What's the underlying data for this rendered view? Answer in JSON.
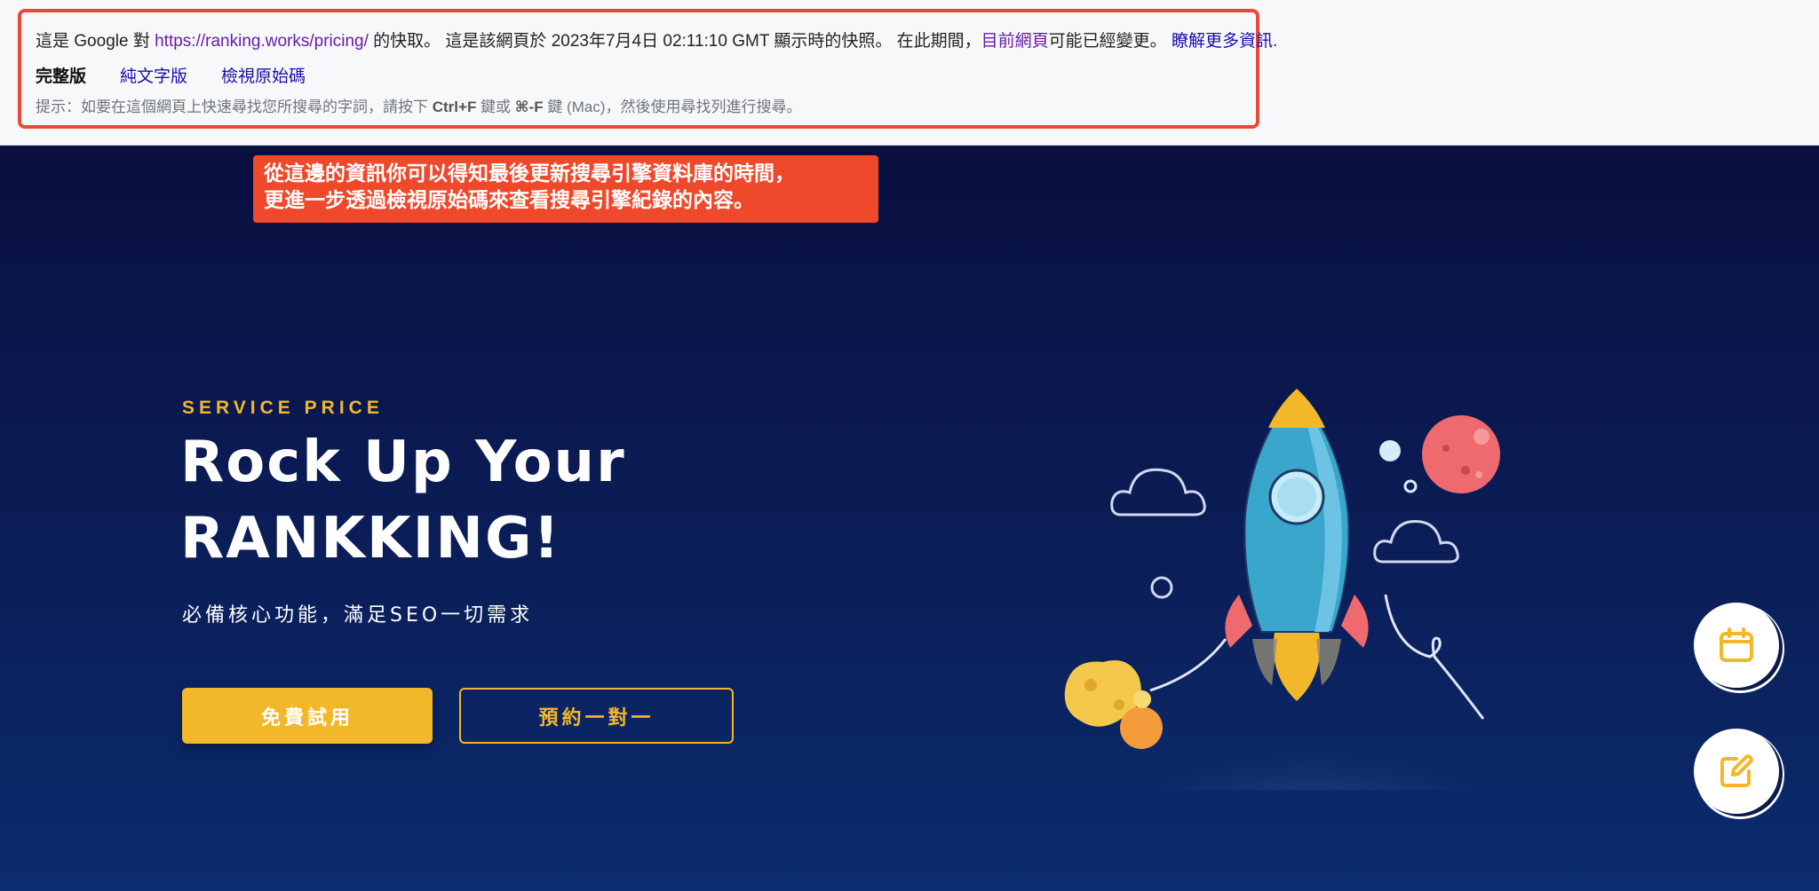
{
  "cache": {
    "prefix": "這是 Google 對 ",
    "url": "https://ranking.works/pricing/",
    "middle": " 的快取。 這是該網頁於 2023年7月4日 02:11:10 GMT 顯示時的快照。 在此期間，",
    "current_page_link": "目前網頁",
    "changed_text": "可能已經變更。 ",
    "learn_more": "瞭解更多資訊",
    "period": ".",
    "versions": {
      "full": "完整版",
      "text_only": "純文字版",
      "view_source": "檢視原始碼"
    },
    "tip_prefix": "提示：如要在這個網頁上快速尋找您所搜尋的字詞，請按下 ",
    "tip_key1": "Ctrl+F",
    "tip_mid": " 鍵或 ",
    "tip_key2": "⌘-F",
    "tip_suffix": " 鍵 (Mac)，然後使用尋找列進行搜尋。"
  },
  "callout": {
    "line1": "從這邊的資訊你可以得知最後更新搜尋引擎資料庫的時間，",
    "line2": "更進一步透過檢視原始碼來查看搜尋引擎紀錄的內容。"
  },
  "hero": {
    "eyebrow": "SERVICE PRICE",
    "headline_line1": "Rock Up Your",
    "headline_line2": "RANKKING!",
    "subhead": "必備核心功能，滿足SEO一切需求",
    "primary_button": "免費試用",
    "secondary_button": "預約一對一"
  },
  "colors": {
    "accent": "#f2b82a",
    "callout": "#f0482a",
    "hero_bg": "#0b1e58"
  },
  "icons": {
    "fab_top": "calendar-icon",
    "fab_bottom": "edit-icon"
  }
}
